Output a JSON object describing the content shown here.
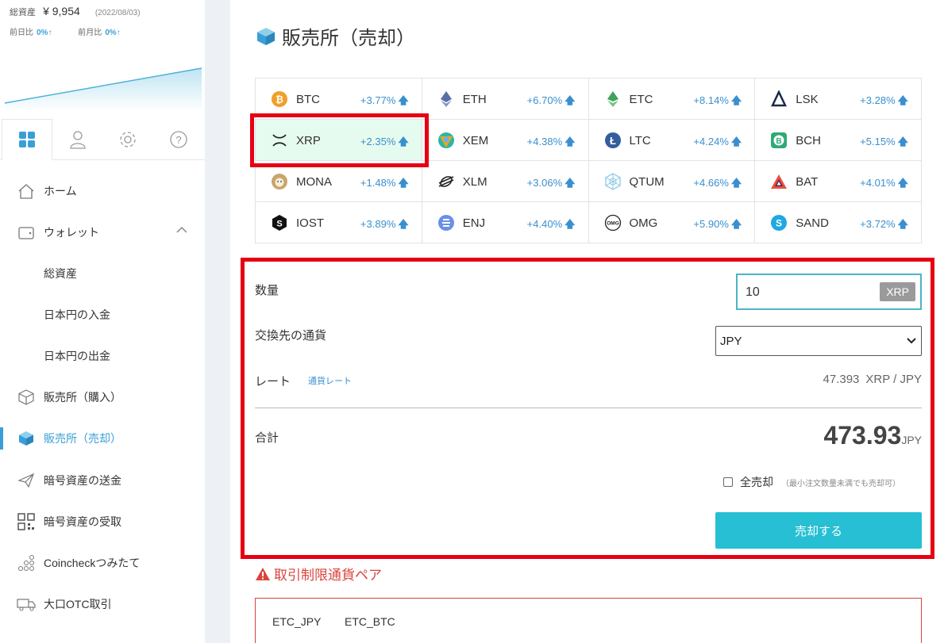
{
  "sidebar": {
    "assets_label": "総資産",
    "assets_amount": "¥ 9,954",
    "assets_date": "(2022/08/03)",
    "day_change_label": "前日比",
    "day_change_value": "0%↑",
    "month_change_label": "前月比",
    "month_change_value": "0%↑",
    "tabs": [
      "dashboard-icon",
      "user-icon",
      "gear-icon",
      "help-icon"
    ],
    "items": [
      {
        "label": "ホーム",
        "icon": "home-icon"
      },
      {
        "label": "ウォレット",
        "icon": "wallet-icon"
      },
      {
        "label": "総資産"
      },
      {
        "label": "日本円の入金"
      },
      {
        "label": "日本円の出金"
      },
      {
        "label": "販売所（購入）",
        "icon": "cube-outline-icon"
      },
      {
        "label": "販売所（売却）",
        "icon": "cube-filled-icon"
      },
      {
        "label": "暗号資産の送金",
        "icon": "paper-plane-icon"
      },
      {
        "label": "暗号資産の受取",
        "icon": "qr-code-icon"
      },
      {
        "label": "Coincheckつみたて",
        "icon": "dots-icon"
      },
      {
        "label": "大口OTC取引",
        "icon": "truck-icon"
      }
    ]
  },
  "main": {
    "title": "販売所（売却）",
    "coins": [
      [
        {
          "symbol": "BTC",
          "change": "+3.77%"
        },
        {
          "symbol": "ETH",
          "change": "+6.70%"
        },
        {
          "symbol": "ETC",
          "change": "+8.14%"
        },
        {
          "symbol": "LSK",
          "change": "+3.28%"
        }
      ],
      [
        {
          "symbol": "XRP",
          "change": "+2.35%"
        },
        {
          "symbol": "XEM",
          "change": "+4.38%"
        },
        {
          "symbol": "LTC",
          "change": "+4.24%"
        },
        {
          "symbol": "BCH",
          "change": "+5.15%"
        }
      ],
      [
        {
          "symbol": "MONA",
          "change": "+1.48%"
        },
        {
          "symbol": "XLM",
          "change": "+3.06%"
        },
        {
          "symbol": "QTUM",
          "change": "+4.66%"
        },
        {
          "symbol": "BAT",
          "change": "+4.01%"
        }
      ],
      [
        {
          "symbol": "IOST",
          "change": "+3.89%"
        },
        {
          "symbol": "ENJ",
          "change": "+4.40%"
        },
        {
          "symbol": "OMG",
          "change": "+5.90%"
        },
        {
          "symbol": "SAND",
          "change": "+3.72%"
        }
      ]
    ],
    "up_arrow": "🡅",
    "form": {
      "qty_label": "数量",
      "qty_value": "10",
      "qty_unit": "XRP",
      "currency_label": "交換先の通貨",
      "currency_value": "JPY",
      "rate_label": "レート",
      "rate_link": "通貨レート",
      "rate_value": "47.393",
      "rate_unit": "XRP / JPY",
      "total_label": "合計",
      "total_value": "473.93",
      "total_unit": "JPY",
      "all_sell_label": "全売却",
      "all_sell_note": "（最小注文数量未満でも売却可）",
      "sell_button": "売却する"
    },
    "restrictions": {
      "title": "取引制限通貨ペア",
      "pairs": [
        "ETC_JPY",
        "ETC_BTC"
      ]
    }
  },
  "colors": {
    "accent": "#26bfd3",
    "link": "#3a8fcf",
    "highlight": "#e60012",
    "warning": "#d9443c"
  }
}
